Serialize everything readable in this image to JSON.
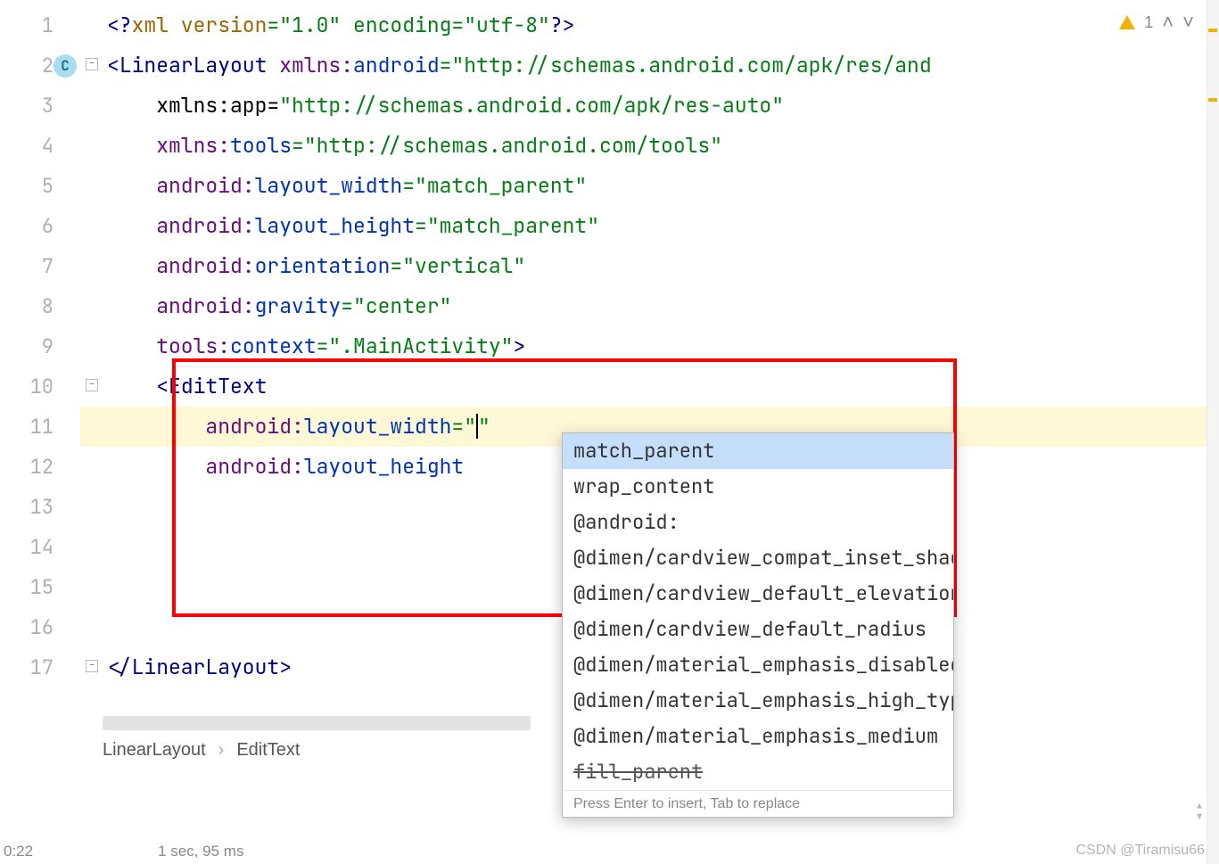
{
  "lines": {
    "1": {
      "pre": "",
      "tokens": [
        {
          "t": "<?",
          "c": "t-tag"
        },
        {
          "t": "xml version",
          "c": "t-pi"
        },
        {
          "t": "=\"1.0\" encoding=\"utf-8\"",
          "c": "t-str"
        },
        {
          "t": "?>",
          "c": "t-tag"
        }
      ]
    },
    "2": {
      "pre": "",
      "fold": "-",
      "tokens": [
        {
          "t": "<",
          "c": "t-tag"
        },
        {
          "t": "LinearLayout ",
          "c": "t-tag"
        },
        {
          "t": "xmlns:",
          "c": "t-ns"
        },
        {
          "t": "android",
          "c": "t-attr"
        },
        {
          "t": "=\"http://schemas.android.com/apk/res/and",
          "c": "t-str"
        }
      ]
    },
    "3": {
      "pre": "    ",
      "tokens": [
        {
          "t": "xmlns:app=",
          "c": ""
        },
        {
          "t": "\"http://schemas.android.com/apk/res-auto\"",
          "c": "t-str"
        }
      ]
    },
    "4": {
      "pre": "    ",
      "tokens": [
        {
          "t": "xmlns:",
          "c": "t-ns"
        },
        {
          "t": "tools",
          "c": "t-attr"
        },
        {
          "t": "=\"http://schemas.android.com/tools\"",
          "c": "t-str"
        }
      ]
    },
    "5": {
      "pre": "    ",
      "tokens": [
        {
          "t": "android:",
          "c": "t-ns"
        },
        {
          "t": "layout_width",
          "c": "t-attr"
        },
        {
          "t": "=\"match_parent\"",
          "c": "t-str"
        }
      ]
    },
    "6": {
      "pre": "    ",
      "tokens": [
        {
          "t": "android:",
          "c": "t-ns"
        },
        {
          "t": "layout_height",
          "c": "t-attr"
        },
        {
          "t": "=\"match_parent\"",
          "c": "t-str"
        }
      ]
    },
    "7": {
      "pre": "    ",
      "tokens": [
        {
          "t": "android:",
          "c": "t-ns"
        },
        {
          "t": "orientation",
          "c": "t-attr"
        },
        {
          "t": "=\"vertical\"",
          "c": "t-str"
        }
      ]
    },
    "8": {
      "pre": "    ",
      "tokens": [
        {
          "t": "android:",
          "c": "t-ns"
        },
        {
          "t": "gravity",
          "c": "t-attr"
        },
        {
          "t": "=\"center\"",
          "c": "t-str"
        }
      ]
    },
    "9": {
      "pre": "    ",
      "tokens": [
        {
          "t": "tools:",
          "c": "t-ns"
        },
        {
          "t": "context",
          "c": "t-attr"
        },
        {
          "t": "=\".MainActivity\"",
          "c": "t-str"
        },
        {
          "t": ">",
          "c": "t-tag"
        }
      ]
    },
    "10": {
      "pre": "    ",
      "fold": "-",
      "tokens": [
        {
          "t": "<",
          "c": "t-tag"
        },
        {
          "t": "EditText",
          "c": "t-tag"
        }
      ]
    },
    "11": {
      "pre": "        ",
      "current": true,
      "tokens": [
        {
          "t": "android:",
          "c": "t-ns"
        },
        {
          "t": "layout_width",
          "c": "t-attr"
        },
        {
          "t": "=\"",
          "c": "t-str"
        },
        {
          "t": "CURSOR",
          "c": "cursor"
        },
        {
          "t": "\"",
          "c": "t-str"
        }
      ]
    },
    "12": {
      "pre": "        ",
      "tokens": [
        {
          "t": "android:",
          "c": "t-ns"
        },
        {
          "t": "layout_height",
          "c": "t-attr"
        }
      ]
    },
    "13": {
      "pre": "",
      "tokens": []
    },
    "14": {
      "pre": "",
      "tokens": []
    },
    "15": {
      "pre": "",
      "tokens": []
    },
    "16": {
      "pre": "",
      "tokens": []
    },
    "17": {
      "pre": "",
      "fold": "-",
      "tokens": [
        {
          "t": "</",
          "c": "t-tag"
        },
        {
          "t": "LinearLayout",
          "c": "t-tag"
        },
        {
          "t": ">",
          "c": "t-tag"
        }
      ]
    }
  },
  "gutter_badge": "C",
  "popup": {
    "items": [
      {
        "label": "match_parent",
        "selected": true
      },
      {
        "label": "wrap_content"
      },
      {
        "label": "@android:"
      },
      {
        "label": "@dimen/cardview_compat_inset_shadow"
      },
      {
        "label": "@dimen/cardview_default_elevation"
      },
      {
        "label": "@dimen/cardview_default_radius"
      },
      {
        "label": "@dimen/material_emphasis_disabled"
      },
      {
        "label": "@dimen/material_emphasis_high_type"
      },
      {
        "label": "@dimen/material_emphasis_medium"
      },
      {
        "label": "fill_parent",
        "deprecated": true
      }
    ],
    "footer": "Press Enter to insert, Tab to replace"
  },
  "breadcrumb": {
    "a": "LinearLayout",
    "b": "EditText",
    "sep": "›"
  },
  "topright": {
    "count": "1"
  },
  "status": {
    "a": "0:22",
    "b": "1 sec, 95 ms"
  },
  "watermark": "CSDN @Tiramisu66"
}
